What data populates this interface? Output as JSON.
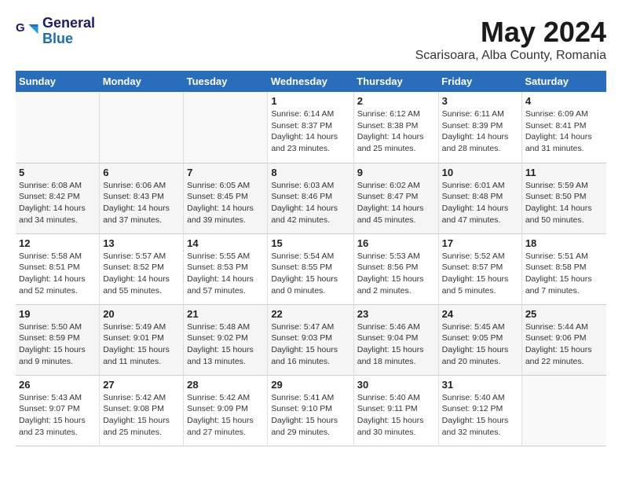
{
  "header": {
    "logo_line1": "General",
    "logo_line2": "Blue",
    "title": "May 2024",
    "subtitle": "Scarisoara, Alba County, Romania"
  },
  "days_of_week": [
    "Sunday",
    "Monday",
    "Tuesday",
    "Wednesday",
    "Thursday",
    "Friday",
    "Saturday"
  ],
  "weeks": [
    [
      {
        "day": "",
        "info": ""
      },
      {
        "day": "",
        "info": ""
      },
      {
        "day": "",
        "info": ""
      },
      {
        "day": "1",
        "info": "Sunrise: 6:14 AM\nSunset: 8:37 PM\nDaylight: 14 hours\nand 23 minutes."
      },
      {
        "day": "2",
        "info": "Sunrise: 6:12 AM\nSunset: 8:38 PM\nDaylight: 14 hours\nand 25 minutes."
      },
      {
        "day": "3",
        "info": "Sunrise: 6:11 AM\nSunset: 8:39 PM\nDaylight: 14 hours\nand 28 minutes."
      },
      {
        "day": "4",
        "info": "Sunrise: 6:09 AM\nSunset: 8:41 PM\nDaylight: 14 hours\nand 31 minutes."
      }
    ],
    [
      {
        "day": "5",
        "info": "Sunrise: 6:08 AM\nSunset: 8:42 PM\nDaylight: 14 hours\nand 34 minutes."
      },
      {
        "day": "6",
        "info": "Sunrise: 6:06 AM\nSunset: 8:43 PM\nDaylight: 14 hours\nand 37 minutes."
      },
      {
        "day": "7",
        "info": "Sunrise: 6:05 AM\nSunset: 8:45 PM\nDaylight: 14 hours\nand 39 minutes."
      },
      {
        "day": "8",
        "info": "Sunrise: 6:03 AM\nSunset: 8:46 PM\nDaylight: 14 hours\nand 42 minutes."
      },
      {
        "day": "9",
        "info": "Sunrise: 6:02 AM\nSunset: 8:47 PM\nDaylight: 14 hours\nand 45 minutes."
      },
      {
        "day": "10",
        "info": "Sunrise: 6:01 AM\nSunset: 8:48 PM\nDaylight: 14 hours\nand 47 minutes."
      },
      {
        "day": "11",
        "info": "Sunrise: 5:59 AM\nSunset: 8:50 PM\nDaylight: 14 hours\nand 50 minutes."
      }
    ],
    [
      {
        "day": "12",
        "info": "Sunrise: 5:58 AM\nSunset: 8:51 PM\nDaylight: 14 hours\nand 52 minutes."
      },
      {
        "day": "13",
        "info": "Sunrise: 5:57 AM\nSunset: 8:52 PM\nDaylight: 14 hours\nand 55 minutes."
      },
      {
        "day": "14",
        "info": "Sunrise: 5:55 AM\nSunset: 8:53 PM\nDaylight: 14 hours\nand 57 minutes."
      },
      {
        "day": "15",
        "info": "Sunrise: 5:54 AM\nSunset: 8:55 PM\nDaylight: 15 hours\nand 0 minutes."
      },
      {
        "day": "16",
        "info": "Sunrise: 5:53 AM\nSunset: 8:56 PM\nDaylight: 15 hours\nand 2 minutes."
      },
      {
        "day": "17",
        "info": "Sunrise: 5:52 AM\nSunset: 8:57 PM\nDaylight: 15 hours\nand 5 minutes."
      },
      {
        "day": "18",
        "info": "Sunrise: 5:51 AM\nSunset: 8:58 PM\nDaylight: 15 hours\nand 7 minutes."
      }
    ],
    [
      {
        "day": "19",
        "info": "Sunrise: 5:50 AM\nSunset: 8:59 PM\nDaylight: 15 hours\nand 9 minutes."
      },
      {
        "day": "20",
        "info": "Sunrise: 5:49 AM\nSunset: 9:01 PM\nDaylight: 15 hours\nand 11 minutes."
      },
      {
        "day": "21",
        "info": "Sunrise: 5:48 AM\nSunset: 9:02 PM\nDaylight: 15 hours\nand 13 minutes."
      },
      {
        "day": "22",
        "info": "Sunrise: 5:47 AM\nSunset: 9:03 PM\nDaylight: 15 hours\nand 16 minutes."
      },
      {
        "day": "23",
        "info": "Sunrise: 5:46 AM\nSunset: 9:04 PM\nDaylight: 15 hours\nand 18 minutes."
      },
      {
        "day": "24",
        "info": "Sunrise: 5:45 AM\nSunset: 9:05 PM\nDaylight: 15 hours\nand 20 minutes."
      },
      {
        "day": "25",
        "info": "Sunrise: 5:44 AM\nSunset: 9:06 PM\nDaylight: 15 hours\nand 22 minutes."
      }
    ],
    [
      {
        "day": "26",
        "info": "Sunrise: 5:43 AM\nSunset: 9:07 PM\nDaylight: 15 hours\nand 23 minutes."
      },
      {
        "day": "27",
        "info": "Sunrise: 5:42 AM\nSunset: 9:08 PM\nDaylight: 15 hours\nand 25 minutes."
      },
      {
        "day": "28",
        "info": "Sunrise: 5:42 AM\nSunset: 9:09 PM\nDaylight: 15 hours\nand 27 minutes."
      },
      {
        "day": "29",
        "info": "Sunrise: 5:41 AM\nSunset: 9:10 PM\nDaylight: 15 hours\nand 29 minutes."
      },
      {
        "day": "30",
        "info": "Sunrise: 5:40 AM\nSunset: 9:11 PM\nDaylight: 15 hours\nand 30 minutes."
      },
      {
        "day": "31",
        "info": "Sunrise: 5:40 AM\nSunset: 9:12 PM\nDaylight: 15 hours\nand 32 minutes."
      },
      {
        "day": "",
        "info": ""
      }
    ]
  ]
}
